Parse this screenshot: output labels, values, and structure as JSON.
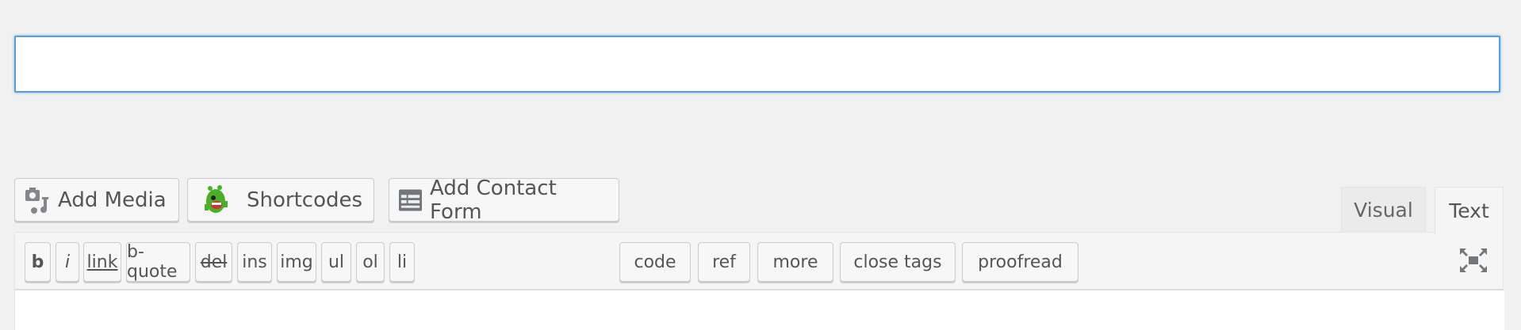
{
  "title_input": {
    "value": "",
    "placeholder": ""
  },
  "media_buttons": [
    {
      "label": "Add Media",
      "icon": "camera-music-icon"
    },
    {
      "label": "Shortcodes",
      "icon": "green-monster-icon"
    },
    {
      "label": "Add Contact Form",
      "icon": "form-icon"
    }
  ],
  "tabs": {
    "visual": "Visual",
    "text": "Text",
    "active": "Text"
  },
  "quicktags": [
    "b",
    "i",
    "link",
    "b-quote",
    "del",
    "ins",
    "img",
    "ul",
    "ol",
    "li",
    "code",
    "ref",
    "more",
    "close tags",
    "proofread"
  ],
  "fullscreen_icon": "fullscreen-icon",
  "colors": {
    "focus_border": "#5b9dd9",
    "background": "#f1f1f1"
  }
}
